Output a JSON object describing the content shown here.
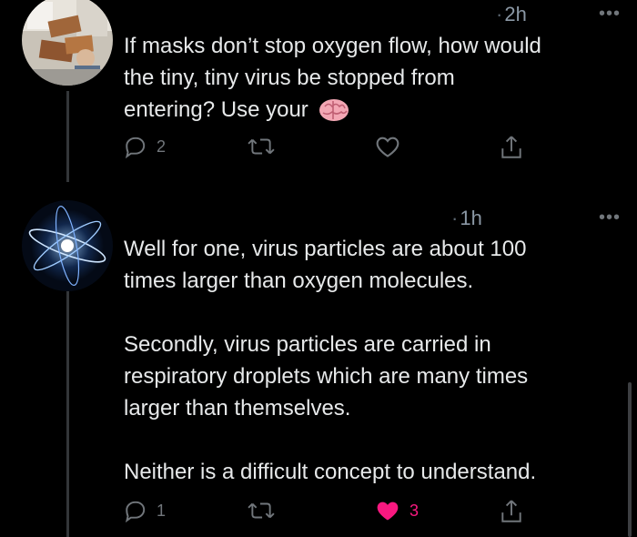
{
  "tweets": [
    {
      "time": "2h",
      "lines": [
        "If masks don’t stop oxygen flow, how would",
        "the tiny, tiny virus be stopped from",
        "entering? Use your"
      ],
      "trailing_icon": "brain-emoji-icon",
      "reply_count": "2",
      "like_count": ""
    },
    {
      "time": "1h",
      "paragraphs": [
        [
          "Well for one, virus particles are about 100",
          "times larger than oxygen molecules."
        ],
        [
          "Secondly, virus particles are carried in",
          "respiratory droplets which are many times",
          "larger than themselves."
        ],
        [
          "Neither is a difficult concept to understand."
        ]
      ],
      "reply_count": "1",
      "like_count": "3",
      "liked": true
    }
  ],
  "more_label": "•••",
  "colors": {
    "like": "#f91880",
    "muted": "#71767b",
    "text": "#e7e9ea"
  }
}
